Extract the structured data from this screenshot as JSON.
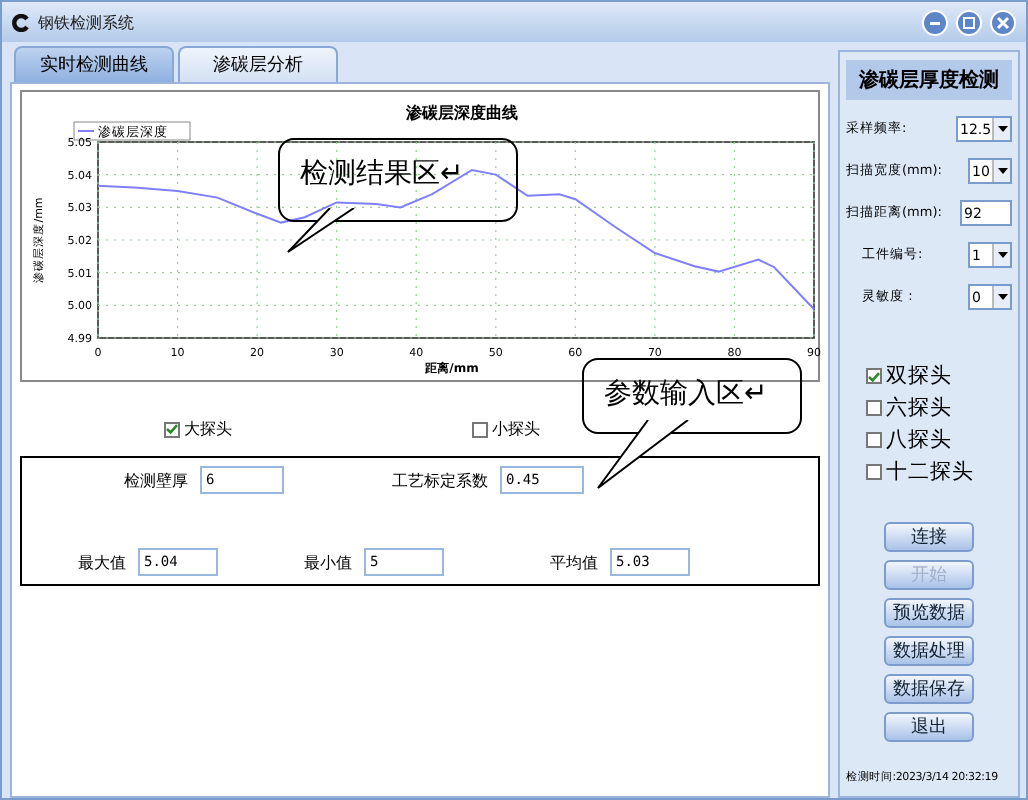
{
  "window": {
    "title": "钢铁检测系统"
  },
  "tabs": [
    {
      "label": "实时检测曲线",
      "selected": true
    },
    {
      "label": "渗碳层分析",
      "selected": false
    }
  ],
  "chart": {
    "chart_data": {
      "type": "line",
      "title": "渗碳层深度曲线",
      "xlabel": "距离/mm",
      "ylabel": "渗碳层深度/mm",
      "x": [
        0,
        5,
        10,
        15,
        20,
        23,
        26,
        30,
        35,
        38,
        42,
        47,
        50,
        54,
        58,
        60,
        65,
        70,
        75,
        78,
        83,
        85,
        90
      ],
      "series": [
        {
          "name": "渗碳层深度",
          "color": "#7f7fff",
          "values": [
            5.0366,
            5.036,
            5.035,
            5.033,
            5.028,
            5.0253,
            5.027,
            5.0315,
            5.031,
            5.03,
            5.034,
            5.0414,
            5.04,
            5.0335,
            5.034,
            5.0325,
            5.024,
            5.016,
            5.012,
            5.0103,
            5.014,
            5.0117,
            4.9988
          ]
        }
      ],
      "xlim": [
        0,
        90
      ],
      "ylim": [
        4.99,
        5.05
      ],
      "xticks": [
        0,
        10,
        20,
        30,
        40,
        50,
        60,
        70,
        80,
        90
      ],
      "yticks": [
        4.99,
        {
          "value": 5.0,
          "label": "5.00"
        },
        5.01,
        5.02,
        5.03,
        5.04,
        5.05
      ],
      "grid": true
    }
  },
  "probe_size": [
    {
      "label": "大探头",
      "checked": true
    },
    {
      "label": "小探头",
      "checked": false
    }
  ],
  "params": {
    "rows": [
      [
        {
          "label": "检测壁厚",
          "value": "6"
        },
        {
          "label": "工艺标定系数",
          "value": "0.45"
        }
      ],
      [
        {
          "label": "最大值",
          "value": "5.04"
        },
        {
          "label": "最小值",
          "value": "5"
        },
        {
          "label": "平均值",
          "value": "5.03"
        }
      ]
    ]
  },
  "callouts": [
    {
      "text": "检测结果区↵"
    },
    {
      "text": "参数输入区↵"
    }
  ],
  "panel": {
    "title": "渗碳层厚度检测",
    "fields": [
      {
        "label": "采样频率:",
        "value": "12.5",
        "kind": "select"
      },
      {
        "label": "扫描宽度(mm):",
        "value": "10",
        "kind": "select"
      },
      {
        "label": "扫描距离(mm):",
        "value": "92",
        "kind": "input"
      },
      {
        "label": "工件编号:",
        "value": "1",
        "kind": "select"
      },
      {
        "label": "灵敏度 :",
        "value": "0",
        "kind": "select"
      }
    ],
    "probes": [
      {
        "label": "双探头",
        "checked": true
      },
      {
        "label": "六探头",
        "checked": false
      },
      {
        "label": "八探头",
        "checked": false
      },
      {
        "label": "十二探头",
        "checked": false
      }
    ],
    "buttons": [
      {
        "label": "连接",
        "disabled": false
      },
      {
        "label": "开始",
        "disabled": true
      },
      {
        "label": "预览数据",
        "disabled": false
      },
      {
        "label": "数据处理",
        "disabled": false
      },
      {
        "label": "数据保存",
        "disabled": false
      },
      {
        "label": "退出",
        "disabled": false
      }
    ]
  },
  "status_bar": {
    "text": "检测时间:2023/3/14 20:32:19"
  }
}
